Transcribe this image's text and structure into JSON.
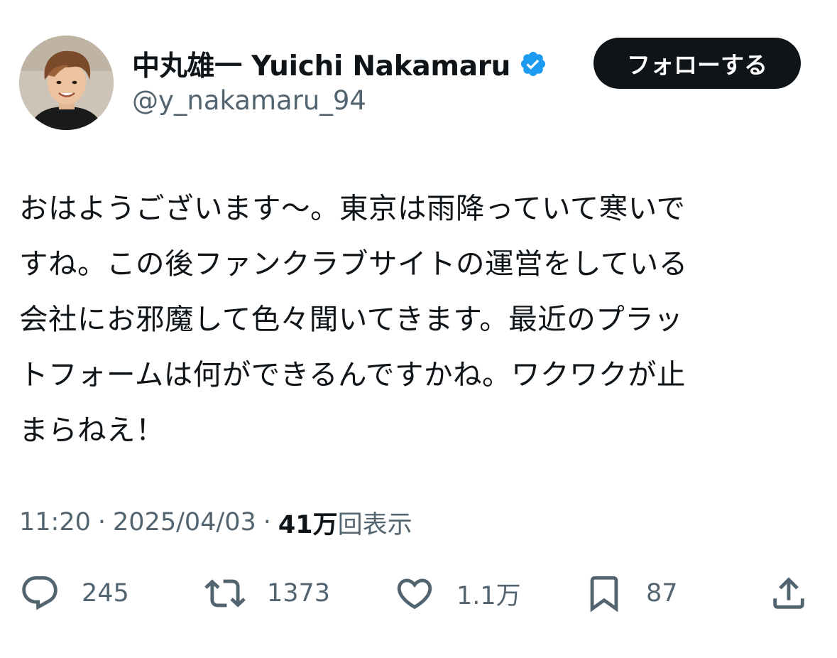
{
  "author": {
    "display_name": "中丸雄一 Yuichi Nakamaru",
    "handle": "@y_nakamaru_94",
    "verified": true,
    "verified_color": "#1d9bf0"
  },
  "follow_button": {
    "label": "フォローする",
    "background": "#0f1419",
    "color": "#ffffff"
  },
  "tweet": {
    "lines": [
      "おはようございます〜。東京は雨降っていて寒いで",
      "すね。この後ファンクラブサイトの運営をしている",
      "会社にお邪魔して色々聞いてきます。最近のプラッ",
      "トフォームは何ができるんですかね。ワクワクが止",
      "まらねえ！"
    ]
  },
  "meta": {
    "time": "11:20",
    "separator": "·",
    "date": "2025/04/03",
    "views_count": "41万",
    "views_label": "回表示"
  },
  "actions": {
    "reply": {
      "icon": "reply-icon",
      "count": "245"
    },
    "repost": {
      "icon": "repost-icon",
      "count": "1373"
    },
    "like": {
      "icon": "heart-icon",
      "count": "1.1万"
    },
    "bookmark": {
      "icon": "bookmark-icon",
      "count": "87"
    },
    "share": {
      "icon": "share-icon"
    }
  },
  "colors": {
    "text_primary": "#0f1419",
    "text_secondary": "#536471",
    "icon": "#536471"
  }
}
